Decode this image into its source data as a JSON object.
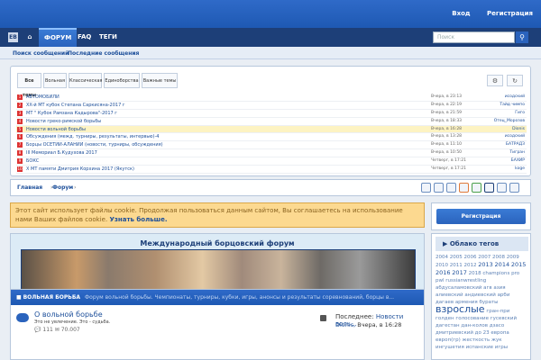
{
  "header": {
    "login": "Вход",
    "register": "Регистрация"
  },
  "nav": {
    "logo": "ЕВ",
    "home_icon": "home-icon",
    "forum": "ФОРУМ",
    "faq": "FAQ",
    "tags": "ТЕГИ",
    "search_placeholder": "Поиск",
    "search_icon": "magnifier-icon"
  },
  "subnav": {
    "search_posts": "Поиск сообщений",
    "latest_posts": "Последние сообщения"
  },
  "topic_tabs": [
    "Все темы",
    "Вольная",
    "Классическая",
    "Единоборства",
    "Важные темы"
  ],
  "topics": [
    {
      "n": "1",
      "title": "АВТОМОБИЛИ",
      "date": "Вчера, в 23:13",
      "author": "исодский"
    },
    {
      "n": "2",
      "title": "XX-й МТ кубок Степана Саркисяна-2017 г",
      "date": "Вчера, в 22:19",
      "author": "Тайд чимпо"
    },
    {
      "n": "3",
      "title": "МТ \" Кубок Рамзана Кадырова\"-2017 г",
      "date": "Вчера, в 21:59",
      "author": "Гиго"
    },
    {
      "n": "4",
      "title": "Новости греко-римской борьбы",
      "date": "Вчера, в 18:33",
      "author": "Отец_Морозов"
    },
    {
      "n": "5",
      "title": "Новости вольной борьбы",
      "date": "Вчера, в 16:28",
      "author": "Dionis"
    },
    {
      "n": "6",
      "title": "Обсуждения (межд. турниры, результаты, интервью)-4",
      "date": "Вчера, в 13:28",
      "author": "исодский"
    },
    {
      "n": "7",
      "title": "Борцы ОСЕТИИ-АЛАНИИ (новости, турниры, обсуждения)",
      "date": "Вчера, в 11:10",
      "author": "БАТРАДЗ"
    },
    {
      "n": "8",
      "title": "III Мемориал Б.Кудухова 2017",
      "date": "Вчера, в 10:50",
      "author": "Тигран"
    },
    {
      "n": "9",
      "title": "БОКС",
      "date": "Четверг, в 17:21",
      "author": "БАХИР"
    },
    {
      "n": "10",
      "title": "X МТ памяти Дмитрия Корхина 2017 (Якутск)",
      "date": "Четверг, в 17:21",
      "author": "koge"
    }
  ],
  "breadcrumb": {
    "home": "Главная",
    "forum": "Форум"
  },
  "cookie": {
    "text": "Этот сайт использует файлы cookie. Продолжая пользоваться данным сайтом, Вы соглашаетесь на использование нами Ваших файлов cookie.",
    "link": "Узнать больше."
  },
  "sidebar": {
    "register": "Регистрация",
    "tag_cloud_title": "Облако тегов"
  },
  "banner": {
    "title": "Международный борцовский форум"
  },
  "tags": [
    {
      "t": "2004",
      "s": "n"
    },
    {
      "t": "2005",
      "s": "n"
    },
    {
      "t": "2006",
      "s": "n"
    },
    {
      "t": "2007",
      "s": "n"
    },
    {
      "t": "2008",
      "s": "n"
    },
    {
      "t": "2009",
      "s": "n"
    },
    {
      "t": "2010",
      "s": "n"
    },
    {
      "t": "2011",
      "s": "n"
    },
    {
      "t": "2012",
      "s": "n"
    },
    {
      "t": "2013",
      "s": "b"
    },
    {
      "t": "2014",
      "s": "b"
    },
    {
      "t": "2015",
      "s": "b"
    },
    {
      "t": "2016",
      "s": "b"
    },
    {
      "t": "2017",
      "s": "b"
    },
    {
      "t": "2018",
      "s": "n"
    },
    {
      "t": "champions",
      "s": "n"
    },
    {
      "t": "pro",
      "s": "n"
    },
    {
      "t": "pwl",
      "s": "n"
    },
    {
      "t": "russianwrestling",
      "s": "n"
    },
    {
      "t": "абдусаламовский",
      "s": "n"
    },
    {
      "t": "агв",
      "s": "n"
    },
    {
      "t": "азия",
      "s": "n"
    },
    {
      "t": "алиевский",
      "s": "n"
    },
    {
      "t": "андиевский",
      "s": "n"
    },
    {
      "t": "арби",
      "s": "n"
    },
    {
      "t": "дагаев",
      "s": "n"
    },
    {
      "t": "армения",
      "s": "n"
    },
    {
      "t": "бураты",
      "s": "n"
    },
    {
      "t": "взрослые",
      "s": "xl"
    },
    {
      "t": "гран-при",
      "s": "n"
    },
    {
      "t": "голден",
      "s": "n"
    },
    {
      "t": "голосование",
      "s": "n"
    },
    {
      "t": "гусевский",
      "s": "n"
    },
    {
      "t": "дагестан",
      "s": "n"
    },
    {
      "t": "дан-колов",
      "s": "n"
    },
    {
      "t": "дзасо",
      "s": "n"
    },
    {
      "t": "дмитриевский",
      "s": "n"
    },
    {
      "t": "до",
      "s": "n"
    },
    {
      "t": "23",
      "s": "n"
    },
    {
      "t": "европа",
      "s": "n"
    },
    {
      "t": "европ(гр)",
      "s": "n"
    },
    {
      "t": "жесткость",
      "s": "n"
    },
    {
      "t": "жук",
      "s": "n"
    },
    {
      "t": "ингушетия",
      "s": "n"
    },
    {
      "t": "испанские",
      "s": "n"
    },
    {
      "t": "игры",
      "s": "n"
    }
  ],
  "section": {
    "title": "ВОЛЬНАЯ БОРЬБА",
    "desc": "Форум вольной борьбы. Чемпионаты, турниры, кубки, игры, анонсы и результаты соревнований, борцы в..."
  },
  "forum_row": {
    "title": "О вольной борьбе",
    "sub": "Это не увлечение. Это - судьба.",
    "threads": "111",
    "posts": "70.007",
    "last_label": "Последнее:",
    "last_title": "Новости воль...",
    "last_user": "Dionis,",
    "last_date": "Вчера, в 16:28"
  },
  "colors": {
    "accent": "#2a63bd",
    "header": "#1e59b3",
    "nav": "#1d3f78",
    "cookie_bg": "#fcd990"
  }
}
